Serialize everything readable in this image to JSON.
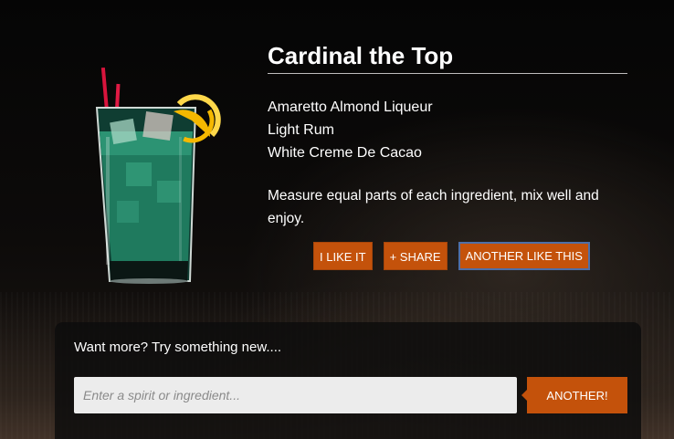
{
  "drink": {
    "name": "Cardinal the Top",
    "ingredients": [
      "Amaretto Almond Liqueur",
      "Light Rum",
      "White Creme De Cacao"
    ],
    "instructions": "Measure equal parts of each ingredient, mix well and enjoy.",
    "image_icon": "cocktail-glass-icon",
    "drink_color": "#1f7a5e"
  },
  "actions": {
    "like_label": "I LIKE IT",
    "share_label": "+ SHARE",
    "another_like_label": "ANOTHER LIKE THIS"
  },
  "search": {
    "prompt": "Want more? Try something new....",
    "placeholder": "Enter a spirit or ingredient...",
    "value": "",
    "button_label": "ANOTHER!"
  },
  "colors": {
    "accent": "#c4520b",
    "background": "#0a0908",
    "input_bg": "#ececec",
    "focus_outline": "#4e6fa8"
  }
}
